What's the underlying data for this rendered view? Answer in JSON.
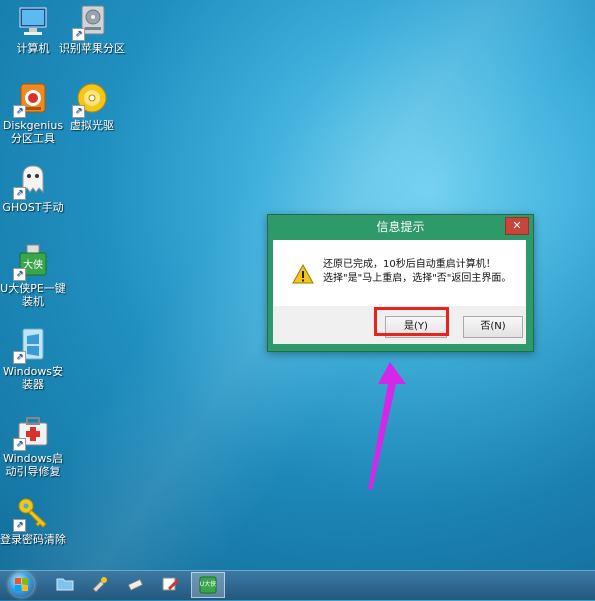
{
  "desktop": {
    "icons": [
      {
        "label": "计算机",
        "icon": "computer-icon"
      },
      {
        "label": "识别苹果分区",
        "icon": "disk-drive-icon"
      },
      {
        "label": "Diskgenius\n分区工具",
        "icon": "diskgenius-icon"
      },
      {
        "label": "虚拟光驱",
        "icon": "virtual-drive-icon"
      },
      {
        "label": "GHOST手动",
        "icon": "ghost-icon"
      },
      {
        "label": "U大侠PE一键\n装机",
        "icon": "udaxia-usb-icon"
      },
      {
        "label": "Windows安\n装器",
        "icon": "windows-installer-icon"
      },
      {
        "label": "Windows启\n动引导修复",
        "icon": "boot-repair-icon"
      },
      {
        "label": "登录密码清除",
        "icon": "key-icon"
      }
    ],
    "usb_badge": "大侠"
  },
  "dialog": {
    "title": "信息提示",
    "close": "✕",
    "line1": "还原已完成，10秒后自动重启计算机！",
    "line2": "选择\"是\"马上重启，选择\"否\"返回主界面。",
    "yes_label": "是(Y)",
    "no_label": "否(N)",
    "accent": "#2e9a6a"
  },
  "annotation": {
    "highlight_color": "#e8231d",
    "arrow_color": "#d428e8"
  },
  "taskbar": {
    "items": [
      "folder-icon",
      "tools-icon",
      "usb-drive-icon",
      "edit-icon",
      "udaxia-app-icon"
    ],
    "active_badge": "U大侠"
  }
}
